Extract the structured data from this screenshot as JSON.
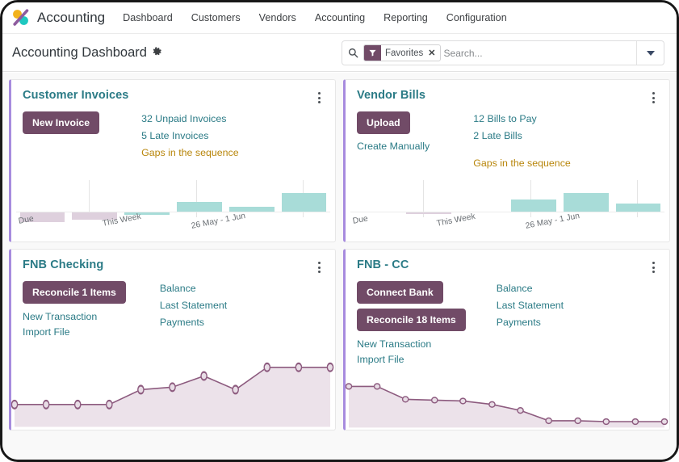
{
  "navbar": {
    "logo_icon": "odoo-logo-icon",
    "app_title": "Accounting",
    "menu": [
      {
        "label": "Dashboard"
      },
      {
        "label": "Customers"
      },
      {
        "label": "Vendors"
      },
      {
        "label": "Accounting"
      },
      {
        "label": "Reporting"
      },
      {
        "label": "Configuration"
      }
    ]
  },
  "control_panel": {
    "breadcrumb": "Accounting Dashboard",
    "settings_icon": "gear-icon",
    "search": {
      "icon": "search-icon",
      "facet_icon": "filter-funnel-icon",
      "facet_label": "Favorites",
      "facet_close": "✕",
      "placeholder": "Search...",
      "value": "",
      "toggle_icon": "chevron-down-icon"
    }
  },
  "cards": {
    "customer_invoices": {
      "title": "Customer Invoices",
      "kebab": "kebab-menu-icon",
      "primary_button": "New Invoice",
      "links": [
        {
          "label": "32 Unpaid Invoices",
          "style": "teal"
        },
        {
          "label": "5 Late Invoices",
          "style": "teal"
        },
        {
          "label": "Gaps in the sequence",
          "style": "warn"
        }
      ]
    },
    "vendor_bills": {
      "title": "Vendor Bills",
      "kebab": "kebab-menu-icon",
      "primary_button": "Upload",
      "secondary_link": "Create Manually",
      "links": [
        {
          "label": "12 Bills to Pay",
          "style": "teal"
        },
        {
          "label": "2 Late Bills",
          "style": "teal"
        },
        {
          "label": "Gaps in the sequence",
          "style": "warn"
        }
      ]
    },
    "fnb_checking": {
      "title": "FNB Checking",
      "kebab": "kebab-menu-icon",
      "primary_button": "Reconcile 1 Items",
      "left_links": [
        {
          "label": "New Transaction"
        },
        {
          "label": "Import File"
        }
      ],
      "right_links": [
        {
          "label": "Balance"
        },
        {
          "label": "Last Statement"
        },
        {
          "label": "Payments"
        }
      ]
    },
    "fnb_cc": {
      "title": "FNB - CC",
      "kebab": "kebab-menu-icon",
      "primary_button_1": "Connect Bank",
      "primary_button_2": "Reconcile 18 Items",
      "left_links": [
        {
          "label": "New Transaction"
        },
        {
          "label": "Import File"
        }
      ],
      "right_links": [
        {
          "label": "Balance"
        },
        {
          "label": "Last Statement"
        },
        {
          "label": "Payments"
        }
      ]
    }
  },
  "colors": {
    "accent_purple": "#714b67",
    "card_left_border": "#a78bde",
    "link_teal": "#2b7b86",
    "link_warn": "#b8860b",
    "bar_past": "#ded0dd",
    "bar_future": "#a8dcd8",
    "line_stroke": "#8d5b7f",
    "line_fill": "#ece2ea"
  },
  "cursor": {
    "icon": "pointer-drop-cursor"
  },
  "chart_data": [
    {
      "type": "bar",
      "name": "customer-invoices-bar-chart",
      "title": "",
      "categories": [
        "Due",
        "",
        "This Week",
        "",
        "26 May - 1 Jun",
        ""
      ],
      "tick_labels": [
        "Due",
        "This Week",
        "26 May - 1 Jun"
      ],
      "values": [
        -14,
        -9,
        -2,
        13,
        7,
        24
      ],
      "bar_colors": [
        "past",
        "past",
        "future",
        "future",
        "future",
        "future"
      ],
      "ylim": [
        -20,
        30
      ],
      "xlabel": "",
      "ylabel": "",
      "grid": true,
      "legend": "none"
    },
    {
      "type": "bar",
      "name": "vendor-bills-bar-chart",
      "title": "",
      "categories": [
        "Due",
        "",
        "This Week",
        "",
        "26 May - 1 Jun",
        ""
      ],
      "tick_labels": [
        "Due",
        "This Week",
        "26 May - 1 Jun"
      ],
      "values": [
        0,
        -2,
        0,
        16,
        24,
        11
      ],
      "bar_colors": [
        "past",
        "past",
        "future",
        "future",
        "future",
        "future"
      ],
      "ylim": [
        -20,
        30
      ],
      "xlabel": "",
      "ylabel": "",
      "grid": true,
      "legend": "none"
    },
    {
      "type": "area",
      "name": "fnb-checking-line-chart",
      "title": "",
      "x": [
        0,
        1,
        2,
        3,
        4,
        5,
        6,
        7,
        8,
        9,
        10
      ],
      "values": [
        10,
        10,
        10,
        10,
        30,
        32,
        45,
        33,
        62,
        62,
        62
      ],
      "ylim": [
        0,
        70
      ],
      "xlabel": "",
      "ylabel": "",
      "grid": false,
      "legend": "none",
      "markers": true
    },
    {
      "type": "area",
      "name": "fnb-cc-line-chart",
      "title": "",
      "x": [
        0,
        1,
        2,
        3,
        4,
        5,
        6,
        7,
        8,
        9,
        10,
        11
      ],
      "values": [
        62,
        62,
        47,
        46,
        45,
        41,
        33,
        20,
        19,
        19,
        18,
        18
      ],
      "ylim": [
        0,
        70
      ],
      "xlabel": "",
      "ylabel": "",
      "grid": false,
      "legend": "none",
      "markers": true
    }
  ]
}
